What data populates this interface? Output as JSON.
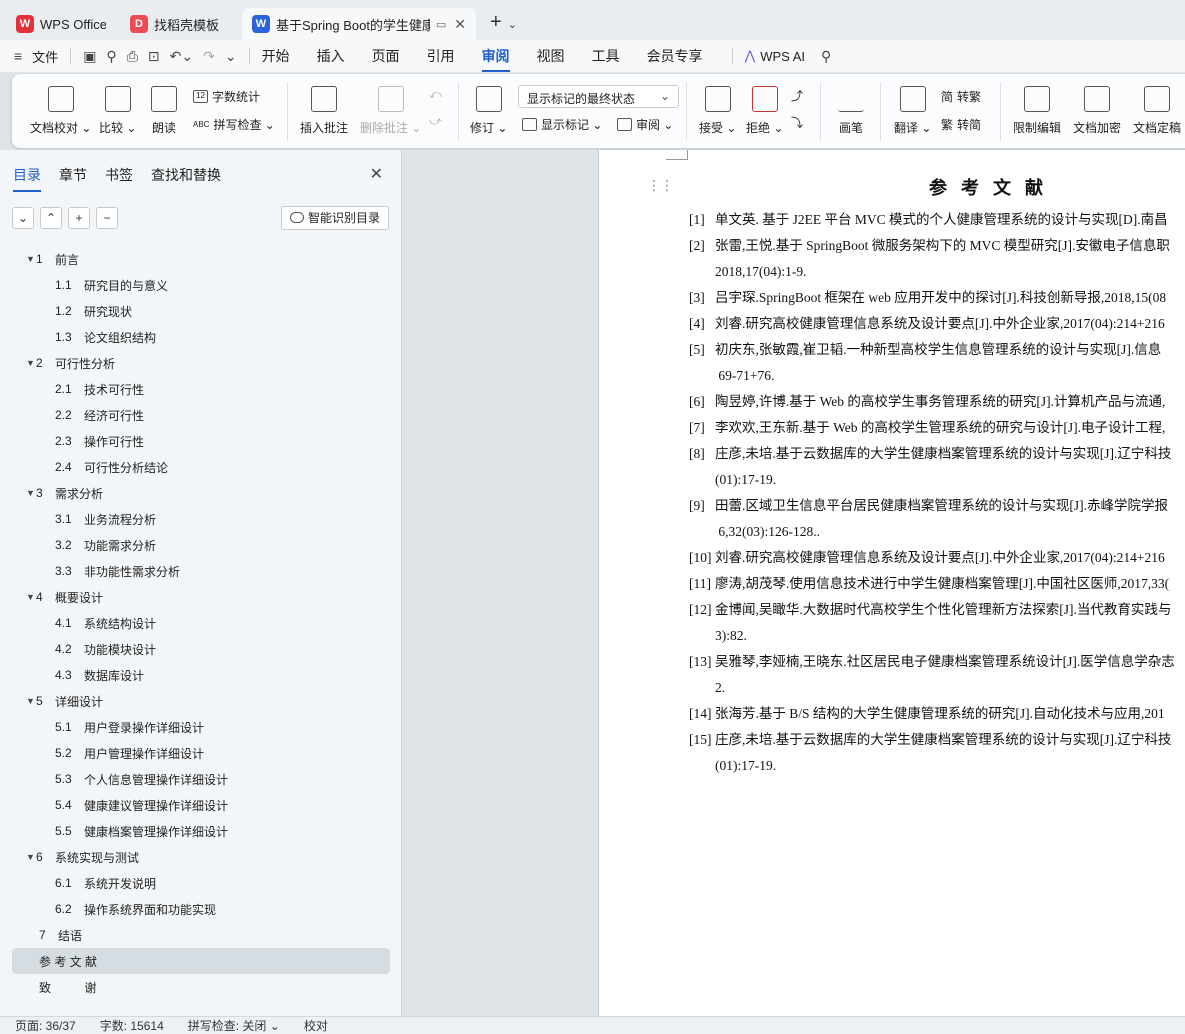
{
  "tabs": [
    {
      "label": "WPS Office",
      "logo": "W",
      "color": "#e5313b",
      "active": false
    },
    {
      "label": "找稻壳模板",
      "logo": "D",
      "color": "#ec4b56",
      "active": false
    },
    {
      "label": "基于Spring Boot的学生健康管",
      "logo": "W",
      "color": "#2c64e0",
      "active": true
    }
  ],
  "menubar": {
    "file": "文件",
    "nav": [
      "开始",
      "插入",
      "页面",
      "引用",
      "审阅",
      "视图",
      "工具",
      "会员专享"
    ],
    "active": "审阅",
    "ai": "WPS AI"
  },
  "ribbon": {
    "doc_check": "文档校对",
    "compare": "比较",
    "read_aloud": "朗读",
    "word_count": "字数统计",
    "spell_check": "拼写检查",
    "insert_comment": "插入批注",
    "delete_comment": "删除批注",
    "revise": "修订",
    "markup_state": "显示标记的最终状态",
    "show_markup": "显示标记",
    "review_pane": "审阅",
    "accept": "接受",
    "reject": "拒绝",
    "ink": "画笔",
    "translate": "翻译",
    "to_traditional": "转繁",
    "to_simplified": "转简",
    "restrict_edit": "限制编辑",
    "encrypt": "文档加密",
    "finalize": "文档定稿"
  },
  "navpane": {
    "tabs": [
      "目录",
      "章节",
      "书签",
      "查找和替换"
    ],
    "active_tab": "目录",
    "smart_toc": "智能识别目录",
    "toc": [
      {
        "level": 1,
        "num": "1",
        "title": "前言",
        "expanded": true
      },
      {
        "level": 2,
        "num": "1.1",
        "title": "研究目的与意义"
      },
      {
        "level": 2,
        "num": "1.2",
        "title": "研究现状"
      },
      {
        "level": 2,
        "num": "1.3",
        "title": "论文组织结构"
      },
      {
        "level": 1,
        "num": "2",
        "title": "可行性分析",
        "expanded": true
      },
      {
        "level": 2,
        "num": "2.1",
        "title": "技术可行性"
      },
      {
        "level": 2,
        "num": "2.2",
        "title": "经济可行性"
      },
      {
        "level": 2,
        "num": "2.3",
        "title": "操作可行性"
      },
      {
        "level": 2,
        "num": "2.4",
        "title": "可行性分析结论"
      },
      {
        "level": 1,
        "num": "3",
        "title": "需求分析",
        "expanded": true
      },
      {
        "level": 2,
        "num": "3.1",
        "title": "业务流程分析"
      },
      {
        "level": 2,
        "num": "3.2",
        "title": "功能需求分析"
      },
      {
        "level": 2,
        "num": "3.3",
        "title": "非功能性需求分析"
      },
      {
        "level": 1,
        "num": "4",
        "title": "概要设计",
        "expanded": true
      },
      {
        "level": 2,
        "num": "4.1",
        "title": "系统结构设计"
      },
      {
        "level": 2,
        "num": "4.2",
        "title": "功能模块设计"
      },
      {
        "level": 2,
        "num": "4.3",
        "title": "数据库设计"
      },
      {
        "level": 1,
        "num": "5",
        "title": "详细设计",
        "expanded": true
      },
      {
        "level": 2,
        "num": "5.1",
        "title": "用户登录操作详细设计"
      },
      {
        "level": 2,
        "num": "5.2",
        "title": "用户管理操作详细设计"
      },
      {
        "level": 2,
        "num": "5.3",
        "title": "个人信息管理操作详细设计"
      },
      {
        "level": 2,
        "num": "5.4",
        "title": "健康建议管理操作详细设计"
      },
      {
        "level": 2,
        "num": "5.5",
        "title": "健康档案管理操作详细设计"
      },
      {
        "level": 1,
        "num": "6",
        "title": "系统实现与测试",
        "expanded": true
      },
      {
        "level": 2,
        "num": "6.1",
        "title": "系统开发说明"
      },
      {
        "level": 2,
        "num": "6.2",
        "title": "操作系统界面和功能实现"
      },
      {
        "level": 0,
        "num": "7",
        "title": "结语"
      },
      {
        "level": 0,
        "num": "",
        "title": "参 考 文 献",
        "selected": true
      },
      {
        "level": 0,
        "num": "",
        "title": "致          谢"
      }
    ]
  },
  "document": {
    "title": "参考文献",
    "refs": [
      {
        "n": "[1]",
        "t": "单文英. 基于 J2EE 平台 MVC 模式的个人健康管理系统的设计与实现[D].南昌"
      },
      {
        "n": "[2]",
        "t": "张雷,王悦.基于 SpringBoot 微服务架构下的 MVC 模型研究[J].安徽电子信息职"
      },
      {
        "n": "",
        "t": "2018,17(04):1-9."
      },
      {
        "n": "[3]",
        "t": "吕宇琛.SpringBoot 框架在 web 应用开发中的探讨[J].科技创新导报,2018,15(08"
      },
      {
        "n": "[4]",
        "t": "刘睿.研究高校健康管理信息系统及设计要点[J].中外企业家,2017(04):214+216"
      },
      {
        "n": "[5]",
        "t": "初庆东,张敏霞,崔卫韬.一种新型高校学生信息管理系统的设计与实现[J].信息"
      },
      {
        "n": "",
        "t": " 69-71+76."
      },
      {
        "n": "[6]",
        "t": "陶昱婷,许博.基于 Web 的高校学生事务管理系统的研究[J].计算机产品与流通,"
      },
      {
        "n": "[7]",
        "t": "李欢欢,王东新.基于 Web 的高校学生管理系统的研究与设计[J].电子设计工程,"
      },
      {
        "n": "[8]",
        "t": "庄彦,未培.基于云数据库的大学生健康档案管理系统的设计与实现[J].辽宁科技"
      },
      {
        "n": "",
        "t": "(01):17-19."
      },
      {
        "n": "[9]",
        "t": "田蕾.区域卫生信息平台居民健康档案管理系统的设计与实现[J].赤峰学院学报"
      },
      {
        "n": "",
        "t": " 6,32(03):126-128.."
      },
      {
        "n": "[10]",
        "t": "刘睿.研究高校健康管理信息系统及设计要点[J].中外企业家,2017(04):214+216"
      },
      {
        "n": "[11]",
        "t": "廖涛,胡茂琴.使用信息技术进行中学生健康档案管理[J].中国社区医师,2017,33("
      },
      {
        "n": "[12]",
        "t": "金博闻,吴瞰华.大数据时代高校学生个性化管理新方法探索[J].当代教育实践与"
      },
      {
        "n": "",
        "t": "3):82."
      },
      {
        "n": "[13]",
        "t": "吴雅琴,李娅楠,王晓东.社区居民电子健康档案管理系统设计[J].医学信息学杂志"
      },
      {
        "n": "",
        "t": "2."
      },
      {
        "n": "[14]",
        "t": "张海芳.基于 B/S 结构的大学生健康管理系统的研究[J].自动化技术与应用,201"
      },
      {
        "n": "[15]",
        "t": "庄彦,未培.基于云数据库的大学生健康档案管理系统的设计与实现[J].辽宁科技"
      },
      {
        "n": "",
        "t": "(01):17-19."
      }
    ]
  },
  "status": {
    "page": "页面: 36/37",
    "words": "字数: 15614",
    "spell": "拼写检查: 关闭",
    "proof": "校对"
  }
}
